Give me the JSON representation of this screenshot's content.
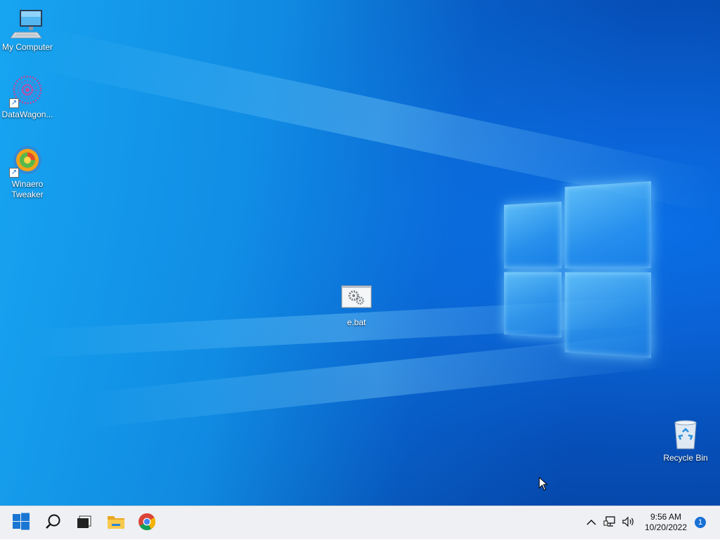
{
  "desktop": {
    "icons": [
      {
        "id": "my-computer",
        "label": "My Computer",
        "icon": "computer-icon"
      },
      {
        "id": "datawagon",
        "label": "DataWagon...",
        "icon": "datawagon-icon",
        "shortcut": true
      },
      {
        "id": "winaero",
        "label": "Winaero Tweaker",
        "icon": "winaero-tweaker-icon",
        "shortcut": true
      },
      {
        "id": "e-bat",
        "label": "e.bat",
        "icon": "batch-file-icon"
      },
      {
        "id": "recycle-bin",
        "label": "Recycle Bin",
        "icon": "recycle-bin-icon"
      }
    ]
  },
  "taskbar": {
    "start": {
      "icon": "windows-start-icon"
    },
    "search": {
      "icon": "search-icon"
    },
    "task_view": {
      "icon": "task-view-icon"
    },
    "pinned": [
      {
        "name": "File Explorer",
        "icon": "file-explorer-icon"
      },
      {
        "name": "Google Chrome",
        "icon": "chrome-icon"
      }
    ],
    "tray": {
      "chevron_icon": "chevron-up-icon",
      "network_icon": "network-icon",
      "volume_icon": "volume-icon",
      "time": "9:56 AM",
      "date": "10/20/2022",
      "notification_count": "1"
    }
  },
  "colors": {
    "taskbar_bg": "#eef0f3",
    "accent": "#1870d5",
    "wallpaper": "#0a63d6"
  }
}
